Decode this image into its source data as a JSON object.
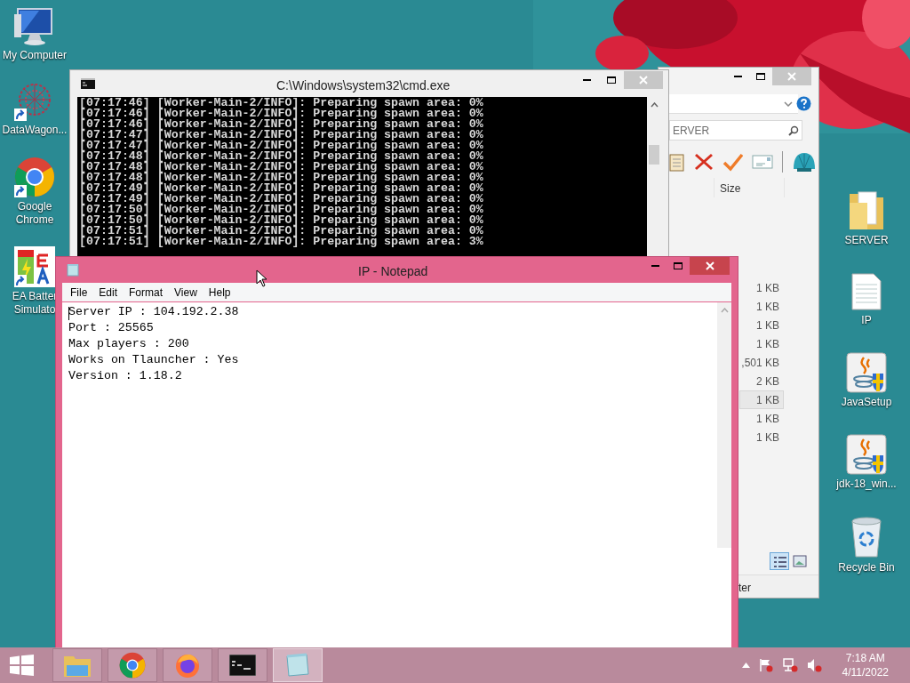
{
  "desktop_left": [
    {
      "kind": "computer",
      "lines": [
        "My Computer"
      ],
      "shortcut": false
    },
    {
      "kind": "network",
      "lines": [
        "DataWagon..."
      ],
      "shortcut": true
    },
    {
      "kind": "chrome",
      "lines": [
        "Google",
        "Chrome"
      ],
      "shortcut": true
    },
    {
      "kind": "battery",
      "lines": [
        "EA Batter",
        "Simulato"
      ],
      "shortcut": true
    }
  ],
  "desktop_right": [
    {
      "kind": "folder",
      "lines": [
        "SERVER"
      ]
    },
    {
      "kind": "textfile",
      "lines": [
        "IP"
      ]
    },
    {
      "kind": "java",
      "lines": [
        "JavaSetup"
      ]
    },
    {
      "kind": "java",
      "lines": [
        "jdk-18_win..."
      ]
    },
    {
      "kind": "recycle",
      "lines": [
        "Recycle Bin"
      ]
    }
  ],
  "explorer": {
    "search": "ERVER",
    "column": "Size",
    "rows": [
      {
        "size": "1 KB",
        "selected": false
      },
      {
        "size": "1 KB",
        "selected": false
      },
      {
        "size": "1 KB",
        "selected": false
      },
      {
        "size": "1 KB",
        "selected": false
      },
      {
        "size": ",501 KB",
        "selected": false
      },
      {
        "size": "2 KB",
        "selected": false
      },
      {
        "size": "1 KB",
        "selected": true
      },
      {
        "size": "1 KB",
        "selected": false
      },
      {
        "size": "1 KB",
        "selected": false
      }
    ],
    "status": "ter"
  },
  "cmd": {
    "title": "C:\\Windows\\system32\\cmd.exe",
    "lines": [
      "[07:17:46] [Worker-Main-2/INFO]: Preparing spawn area: 0%",
      "[07:17:46] [Worker-Main-2/INFO]: Preparing spawn area: 0%",
      "[07:17:46] [Worker-Main-2/INFO]: Preparing spawn area: 0%",
      "[07:17:47] [Worker-Main-2/INFO]: Preparing spawn area: 0%",
      "[07:17:47] [Worker-Main-2/INFO]: Preparing spawn area: 0%",
      "[07:17:48] [Worker-Main-2/INFO]: Preparing spawn area: 0%",
      "[07:17:48] [Worker-Main-2/INFO]: Preparing spawn area: 0%",
      "[07:17:48] [Worker-Main-2/INFO]: Preparing spawn area: 0%",
      "[07:17:49] [Worker-Main-2/INFO]: Preparing spawn area: 0%",
      "[07:17:49] [Worker-Main-2/INFO]: Preparing spawn area: 0%",
      "[07:17:50] [Worker-Main-2/INFO]: Preparing spawn area: 0%",
      "[07:17:50] [Worker-Main-2/INFO]: Preparing spawn area: 0%",
      "[07:17:51] [Worker-Main-2/INFO]: Preparing spawn area: 0%",
      "[07:17:51] [Worker-Main-2/INFO]: Preparing spawn area: 3%"
    ]
  },
  "notepad": {
    "title": "IP - Notepad",
    "menu": [
      "File",
      "Edit",
      "Format",
      "View",
      "Help"
    ],
    "lines": [
      "Server IP : 104.192.2.38",
      "Port : 25565",
      "Max players : 200",
      "Works on Tlauncher : Yes",
      "Version : 1.18.2"
    ]
  },
  "taskbar": {
    "items": [
      {
        "kind": "explorer",
        "active": false
      },
      {
        "kind": "chrome",
        "active": false
      },
      {
        "kind": "firefox",
        "active": false
      },
      {
        "kind": "cmd",
        "active": false
      },
      {
        "kind": "notepad",
        "active": true
      }
    ],
    "time": "7:18 AM",
    "date": "4/11/2022"
  }
}
